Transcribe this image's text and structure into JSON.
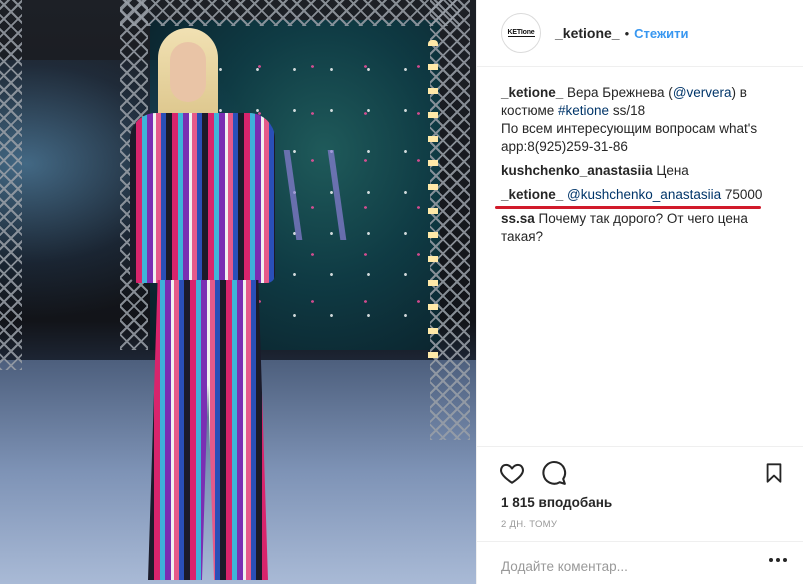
{
  "post": {
    "author": "_ketione_",
    "avatar_text": "KETIone",
    "separator": "•",
    "follow_label": "Стежити"
  },
  "comments": [
    {
      "user": "_ketione_",
      "parts": [
        {
          "type": "text",
          "text": " Вера Брежнева ("
        },
        {
          "type": "mention",
          "text": "@ververa"
        },
        {
          "type": "text",
          "text": ") в костюме "
        },
        {
          "type": "tag",
          "text": "#ketione"
        },
        {
          "type": "text",
          "text": " ss/18"
        }
      ],
      "extra": "По всем интересующим вопросам what's app:8(925)259-31-86"
    },
    {
      "user": "kushchenko_anastasiia",
      "text": " Цена"
    },
    {
      "user": "_ketione_",
      "mention": "@kushchenko_anastasiia",
      "text": " 75000",
      "underlined": true
    },
    {
      "user": "ss.sa",
      "text": " Почему так дорого? От чего цена такая?"
    }
  ],
  "actions": {
    "like_icon": "heart-icon",
    "comment_icon": "comment-icon",
    "save_icon": "bookmark-icon"
  },
  "likes_text": "1 815 вподобань",
  "time_text": "2 ДН. ТОМУ",
  "comment_input": {
    "placeholder": "Додайте коментар...",
    "value": ""
  },
  "colors": {
    "link": "#3897f0",
    "mention": "#003569",
    "underline": "#d11a2a"
  }
}
